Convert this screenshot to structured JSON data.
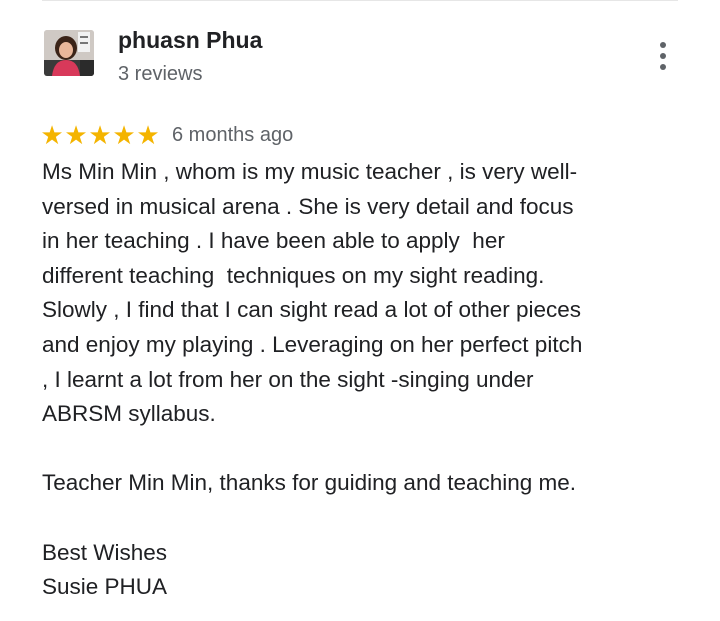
{
  "review": {
    "reviewer_name": "phuasn Phua",
    "review_count": "3 reviews",
    "rating": 5,
    "rating_max": 5,
    "star_glyph": "★",
    "star_color": "#f4b400",
    "time_ago": "6 months ago",
    "more_icon": "more-vertical-icon",
    "body_lines": [
      "Ms Min Min , whom is my music teacher , is very well-",
      "versed in musical arena . She is very detail and focus",
      "in her teaching . I have been able to apply  her",
      "different teaching  techniques on my sight reading.",
      "Slowly , I find that I can sight read a lot of other pieces",
      "and enjoy my playing . Leveraging on her perfect pitch",
      ", I learnt a lot from her on the sight -singing under",
      "ABRSM syllabus.",
      "",
      "Teacher Min Min, thanks for guiding and teaching me.",
      "",
      "Best Wishes",
      "Susie PHUA"
    ]
  }
}
